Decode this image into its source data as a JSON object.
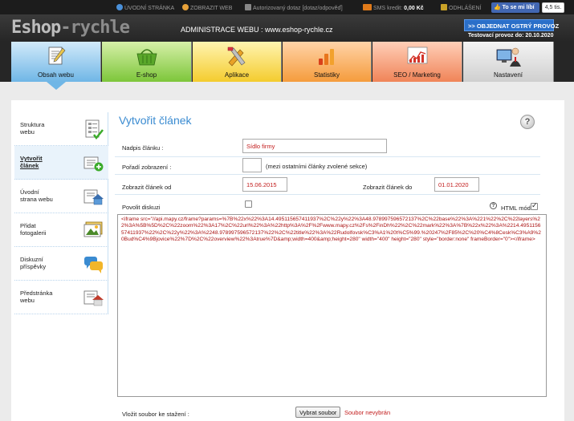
{
  "topbar": {
    "home_link": "ÚVODNÍ STRÁNKA",
    "view_web": "ZOBRAZIT WEB",
    "authorized_query": "Autorizovaný dotaz [dotaz/odpověď]",
    "sms_label": "SMS kredit:",
    "sms_value": "0,00 Kč",
    "logout": "ODHLÁŠENÍ",
    "fb_like": "To se mi líbí",
    "fb_count": "4,5 tis."
  },
  "header": {
    "logo_main": "Eshop",
    "logo_rest": "-rychle",
    "admin_title": "ADMINISTRACE WEBU : www.eshop-rychle.cz",
    "order_button": ">> OBJEDNAT OSTRÝ PROVOZ",
    "trial_text": "Testovací provoz do: 20.10.2020"
  },
  "nav": {
    "tabs": [
      {
        "label": "Obsah webu",
        "icon": "document-pencil-icon"
      },
      {
        "label": "E-shop",
        "icon": "basket-icon"
      },
      {
        "label": "Aplikace",
        "icon": "tools-icon"
      },
      {
        "label": "Statistiky",
        "icon": "bar-chart-icon"
      },
      {
        "label": "SEO / Marketing",
        "icon": "line-chart-icon"
      },
      {
        "label": "Nastavení",
        "icon": "admin-person-icon"
      }
    ],
    "active_tab": "Obsah webu"
  },
  "sidebar": {
    "items": [
      {
        "label": "Struktura\nwebu",
        "icon": "structure-icon"
      },
      {
        "label": "Vytvořit\nčlánek",
        "icon": "new-article-icon",
        "active": true
      },
      {
        "label": "Úvodní\nstrana webu",
        "icon": "home-page-icon"
      },
      {
        "label": "Přidat\nfotogalerii",
        "icon": "photo-gallery-icon"
      },
      {
        "label": "Diskuzní\npříspěvky",
        "icon": "discussion-icon"
      },
      {
        "label": "Předstránka\nwebu",
        "icon": "pre-page-icon"
      }
    ]
  },
  "main": {
    "title": "Vytvořit článek",
    "fields": {
      "heading_label": "Nadpis článku :",
      "heading_value": "Sídlo firmy",
      "order_label": "Pořadí zobrazení :",
      "order_value": "",
      "order_hint": "(mezi ostatními články zvolené sekce)",
      "show_from_label": "Zobrazit článek od",
      "show_from_value": "15.06.2015",
      "show_to_label": "Zobrazit článek do",
      "show_to_value": "01.01.2020",
      "discussion_label": "Povolit diskuzi",
      "discussion_checked": false,
      "html_mode_label": "HTML mód",
      "html_mode_checked": true
    },
    "editor_content": "<iframe src=\"//api.mapy.cz/frame?params=%7B%22x%22%3A14.495115657411937%2C%22y%22%3A48.978997596572137%2C%22base%22%3A%221%22%2C%22layers%22%3A%5B%5D%2C%22zoom%22%3A17%2C%22url%22%3A%22http%3A%2F%2Fwww.mapy.cz%2Fs%2FinDh%22%2C%22mark%22%3A%7B%22x%22%3A%2214.495115657411937%22%2C%22y%22%3A%2248.978997596572137%22%2C%22title%22%3A%22Rudolfovsk%C3%A1%20t%C5%99.%20247%2F85%2C%20%C4%8Cesk%C3%A9%20Bud%C4%9Bjovice%22%7D%2C%22overview%22%3Atrue%7D&amp;width=400&amp;height=280\" width=\"400\" height=\"280\" style=\"border:none\" frameBorder=\"0\"></iframe>",
    "file_label": "Vložit soubor ke stažení :",
    "file_button": "Vybrat soubor",
    "file_status": "Soubor nevybrán"
  },
  "colors": {
    "title_blue": "#3a8bd1",
    "value_red": "#c21b1b",
    "order_button_blue": "#2a6fc9"
  }
}
